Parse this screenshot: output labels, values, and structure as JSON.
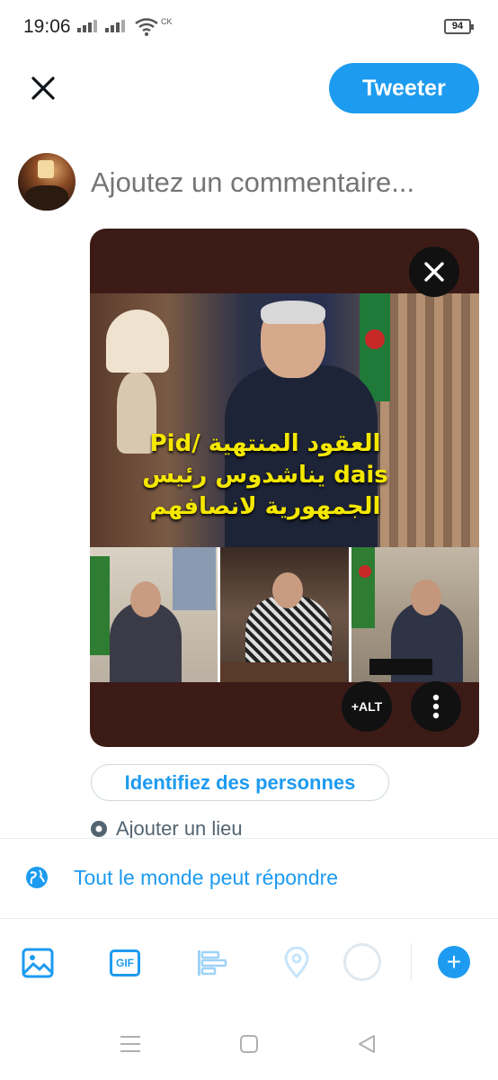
{
  "status_bar": {
    "time": "19:06",
    "wifi_label": "CK",
    "battery": "94"
  },
  "header": {
    "close_icon": "close-icon",
    "tweet_label": "Tweeter"
  },
  "composer": {
    "placeholder": "Ajoutez un commentaire..."
  },
  "media": {
    "image_text_lines": [
      "العقود المنتهية /Pid",
      "dais يناشدوس رئيس",
      "الجمهورية لانصافهم"
    ],
    "alt_label": "+ALT",
    "close_icon": "close-icon",
    "more_icon": "more-vertical-icon"
  },
  "tag_people_label": "Identifiez des personnes",
  "add_location_label": "Ajouter un lieu",
  "reply_setting_label": "Tout le monde peut répondre",
  "toolbar": {
    "items": [
      "image-icon",
      "gif-icon",
      "poll-icon",
      "location-icon"
    ],
    "gif_label": "GIF",
    "add_label": "+"
  },
  "colors": {
    "accent": "#1d9bf0",
    "media_bg": "#3c1b17",
    "image_text": "#f5e800"
  }
}
